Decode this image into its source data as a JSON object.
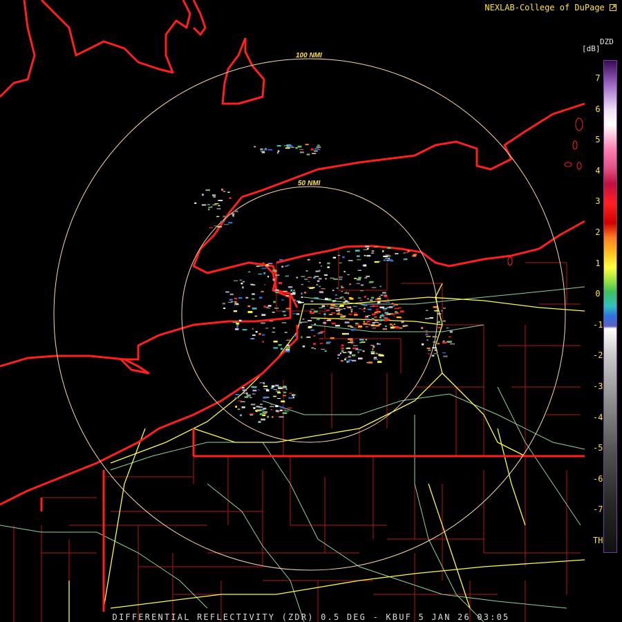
{
  "credit": "NEXLAB-College of DuPage",
  "caption": "DIFFERENTIAL REFLECTIVITY (ZDR) 0.5 DEG - KBUF 5 JAN 26 03:05",
  "range_rings": [
    {
      "label": "50 NMI"
    },
    {
      "label": "100 NMI"
    }
  ],
  "legend": {
    "product": "DZD",
    "unit": "[dB]",
    "ticks": [
      "7",
      "6",
      "5",
      "4",
      "3",
      "2",
      "1",
      "0",
      "-1",
      "-2",
      "-3",
      "-4",
      "-5",
      "-6",
      "-7",
      "TH"
    ]
  },
  "colors": {
    "state_border": "#ff1f1f",
    "county_border": "#b81414",
    "interstate": "#ffff3a",
    "highway": "#8fd59a",
    "range_ring": "#ffd8a8",
    "label": "#ffe23a"
  },
  "icons": [
    "external-link-icon"
  ]
}
